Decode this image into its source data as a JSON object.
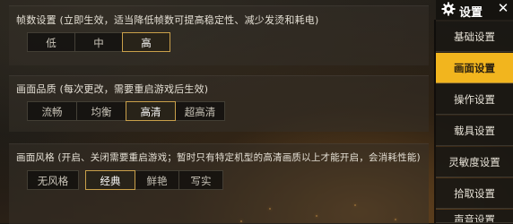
{
  "header": {
    "title": "设置",
    "gear_icon": "gear-icon",
    "close_icon": "close-icon",
    "close_glyph": "✕"
  },
  "sidebar": {
    "items": [
      {
        "label": "基础设置",
        "active": false
      },
      {
        "label": "画面设置",
        "active": true
      },
      {
        "label": "操作设置",
        "active": false
      },
      {
        "label": "载具设置",
        "active": false
      },
      {
        "label": "灵敏度设置",
        "active": false
      },
      {
        "label": "拾取设置",
        "active": false
      },
      {
        "label": "声音设置",
        "active": false
      }
    ]
  },
  "sections": {
    "framerate": {
      "title": "帧数设置 (立即生效，适当降低帧数可提高稳定性、减少发烫和耗电)",
      "options": [
        "低",
        "中",
        "高"
      ],
      "selected": "高"
    },
    "quality": {
      "title": "画面品质 (每次更改，需要重启游戏后生效)",
      "options": [
        "流畅",
        "均衡",
        "高清",
        "超高清"
      ],
      "selected": "高清"
    },
    "style": {
      "title": "画面风格 (开启、关闭需要重启游戏；暂时只有特定机型的高清画质以上才能开启，会消耗性能)",
      "options": [
        "无风格",
        "经典",
        "鲜艳",
        "写实"
      ],
      "selected": "经典"
    }
  },
  "colors": {
    "accent": "#f2b51e",
    "selected_border": "#c9a04a"
  }
}
